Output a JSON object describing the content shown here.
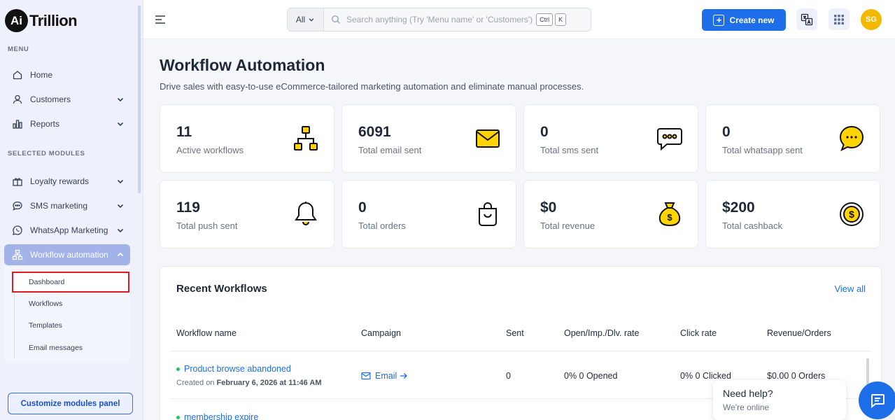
{
  "brand": {
    "logo_mark": "Ai",
    "logo_text": "Trillion"
  },
  "sidebar": {
    "menu_label": "MENU",
    "menu_items": [
      {
        "label": "Home",
        "icon": "home-icon"
      },
      {
        "label": "Customers",
        "icon": "user-icon"
      },
      {
        "label": "Reports",
        "icon": "bar-chart-icon"
      }
    ],
    "modules_label": "SELECTED MODULES",
    "module_items": [
      {
        "label": "Loyalty rewards",
        "icon": "gift-icon"
      },
      {
        "label": "SMS marketing",
        "icon": "chat-bubble-icon"
      },
      {
        "label": "WhatsApp Marketing",
        "icon": "whatsapp-icon"
      },
      {
        "label": "Workflow automation",
        "icon": "workflow-icon",
        "active": true
      }
    ],
    "sub_items": [
      "Dashboard",
      "Workflows",
      "Templates",
      "Email messages"
    ],
    "customize_label": "Customize modules panel"
  },
  "header": {
    "search_scope": "All",
    "search_placeholder": "Search anything (Try 'Menu name' or 'Customers')",
    "shortcut_keys": [
      "Ctrl",
      "K"
    ],
    "create_label": "Create new",
    "avatar_initials": "SG"
  },
  "page": {
    "title": "Workflow Automation",
    "subtitle": "Drive sales with easy-to-use eCommerce-tailored marketing automation and eliminate manual processes."
  },
  "stats": [
    {
      "value": "11",
      "label": "Active workflows",
      "icon": "workflow-tree-icon"
    },
    {
      "value": "6091",
      "label": "Total email sent",
      "icon": "envelope-icon"
    },
    {
      "value": "0",
      "label": "Total sms sent",
      "icon": "sms-bubble-icon"
    },
    {
      "value": "0",
      "label": "Total whatsapp sent",
      "icon": "whatsapp-bubble-icon"
    },
    {
      "value": "119",
      "label": "Total push sent",
      "icon": "bell-icon"
    },
    {
      "value": "0",
      "label": "Total orders",
      "icon": "shopping-bag-icon"
    },
    {
      "value": "$0",
      "label": "Total revenue",
      "icon": "money-bag-icon"
    },
    {
      "value": "$200",
      "label": "Total cashback",
      "icon": "coin-icon"
    }
  ],
  "recent": {
    "title": "Recent Workflows",
    "view_all": "View all",
    "columns": [
      "Workflow name",
      "Campaign",
      "Sent",
      "Open/Imp./Dlv. rate",
      "Click rate",
      "Revenue/Orders"
    ],
    "rows": [
      {
        "name": "Product browse abandoned",
        "created_prefix": "Created on",
        "created_date": "February 6, 2026 at 11:46 AM",
        "campaign": "Email",
        "sent": "0",
        "open_rate": "0% 0 Opened",
        "click_rate": "0% 0 Clicked",
        "revenue": "$0.00 0 Orders"
      },
      {
        "name": "membership expire"
      }
    ]
  },
  "help": {
    "title": "Need help?",
    "status": "We're online"
  },
  "colors": {
    "primary": "#1d6ee8",
    "active_nav": "#a3b3ea",
    "highlight_border": "#e01b24",
    "icon_yellow": "#ffd400"
  }
}
